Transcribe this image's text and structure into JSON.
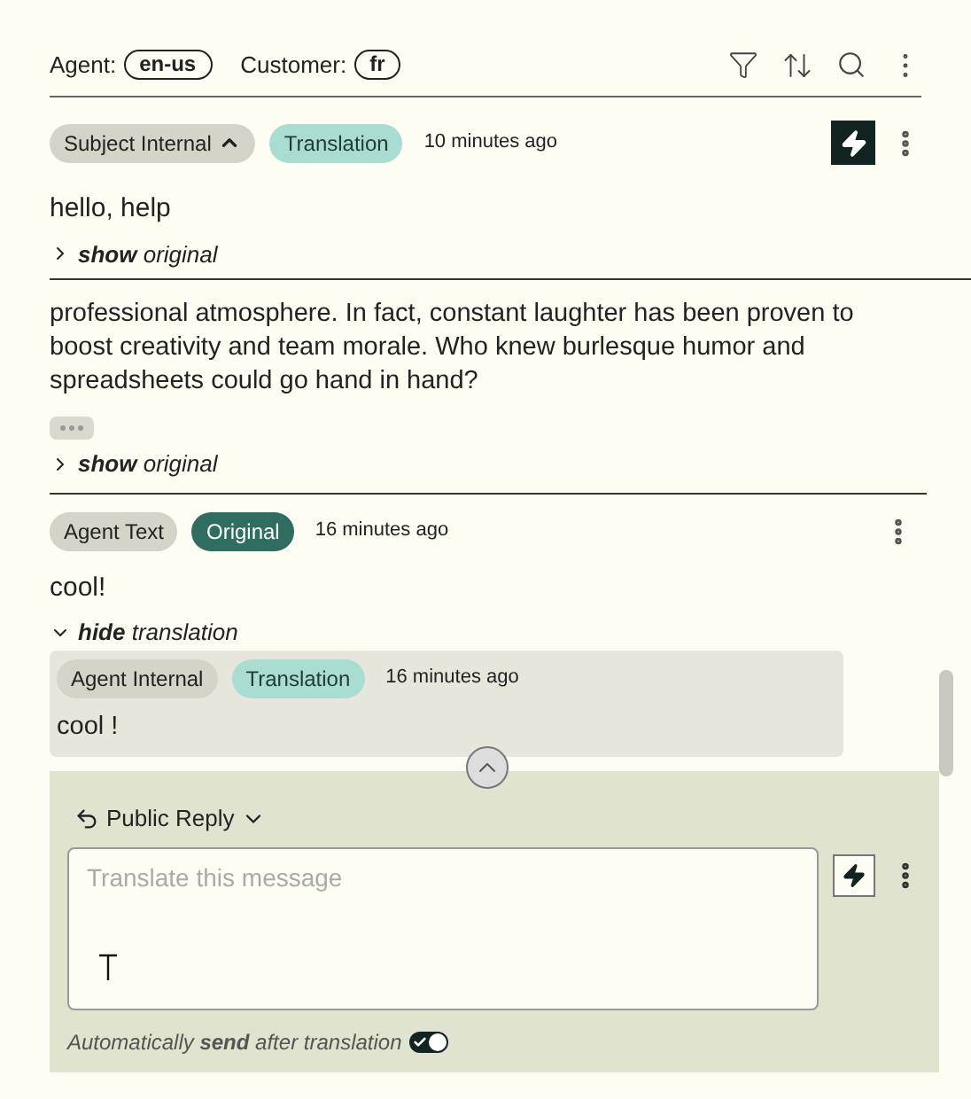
{
  "header": {
    "agent_label": "Agent:",
    "agent_language": "en-us",
    "customer_label": "Customer:",
    "customer_language": "fr"
  },
  "messages": [
    {
      "tags": [
        {
          "label": "Subject Internal",
          "kind": "type",
          "expanded": true
        },
        {
          "label": "Translation",
          "kind": "translation"
        }
      ],
      "time": "10 minutes ago",
      "auto_action": true,
      "body": [
        "hello, help"
      ],
      "toggle": {
        "text": "**show** original",
        "expanded": false
      }
    },
    {
      "body": [
        "professional atmosphere. In fact, constant laughter has been proven to",
        "boost creativity and team morale. Who knew burlesque humor and",
        "spreadsheets could go hand in hand?"
      ],
      "more": true,
      "toggle": {
        "text": "**show** original",
        "expanded": false
      }
    },
    {
      "tags": [
        {
          "label": "Agent Text",
          "kind": "type"
        },
        {
          "label": "Original",
          "kind": "original"
        }
      ],
      "time": "16 minutes ago",
      "body": [
        "cool!"
      ],
      "toggle": {
        "text": "**hide** translation",
        "expanded": true
      },
      "translation": {
        "tags": [
          {
            "label": "Agent Internal",
            "kind": "type"
          },
          {
            "label": "Translation",
            "kind": "translation"
          }
        ],
        "time": "16 minutes ago",
        "body": "cool !"
      }
    }
  ],
  "composer": {
    "reply_mode": "Public Reply",
    "placeholder": "Translate this message",
    "auto_send": {
      "text": "Automatically **send** after translation",
      "on": true
    }
  }
}
